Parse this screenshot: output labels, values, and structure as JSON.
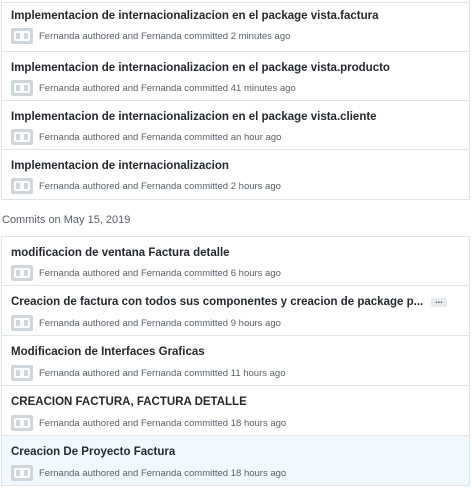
{
  "group1": {
    "commits": [
      {
        "title": "Implementacion de internacionalizacion en el package vista.factura",
        "author": "Fernanda",
        "authored_text": "authored and",
        "committer": "Fernanda",
        "committed_text": "committed",
        "time": "2 minutes ago"
      },
      {
        "title": "Implementacion de internacionalizacion en el package vista.producto",
        "author": "Fernanda",
        "authored_text": "authored and",
        "committer": "Fernanda",
        "committed_text": "committed",
        "time": "41 minutes ago"
      },
      {
        "title": "Implementacion de internacionalizacion en el package vista.cliente",
        "author": "Fernanda",
        "authored_text": "authored and",
        "committer": "Fernanda",
        "committed_text": "committed",
        "time": "an hour ago"
      },
      {
        "title": "Implementacion de internacionalizacion",
        "author": "Fernanda",
        "authored_text": "authored and",
        "committer": "Fernanda",
        "committed_text": "committed",
        "time": "2 hours ago"
      }
    ]
  },
  "day_header": {
    "label": "Commits on May 15, 2019"
  },
  "group2": {
    "commits": [
      {
        "title": "modificacion de ventana Factura detalle",
        "author": "Fernanda",
        "authored_text": "authored and",
        "committer": "Fernanda",
        "committed_text": "committed",
        "time": "6 hours ago"
      },
      {
        "title": "Creacion de factura con todos sus componentes y creacion de package p...",
        "ellipsis_label": "...",
        "author": "Fernanda",
        "authored_text": "authored and",
        "committer": "Fernanda",
        "committed_text": "committed",
        "time": "9 hours ago"
      },
      {
        "title": "Modificacion de Interfaces Graficas",
        "author": "Fernanda",
        "authored_text": "authored and",
        "committer": "Fernanda",
        "committed_text": "committed",
        "time": "11 hours ago"
      },
      {
        "title": "CREACION FACTURA, FACTURA DETALLE",
        "author": "Fernanda",
        "authored_text": "authored and",
        "committer": "Fernanda",
        "committed_text": "committed",
        "time": "18 hours ago"
      },
      {
        "title": "Creacion De Proyecto Factura",
        "author": "Fernanda",
        "authored_text": "authored and",
        "committer": "Fernanda",
        "committed_text": "committed",
        "time": "18 hours ago"
      }
    ]
  },
  "icons": {
    "avatar": "github-identicon-avatar-icon"
  },
  "colors": {
    "title_text": "#24292e",
    "meta_text": "#586069",
    "border": "#e1e4e8",
    "highlight_row": "#f1f8ff",
    "avatar_bg": "#cfd6dc"
  }
}
